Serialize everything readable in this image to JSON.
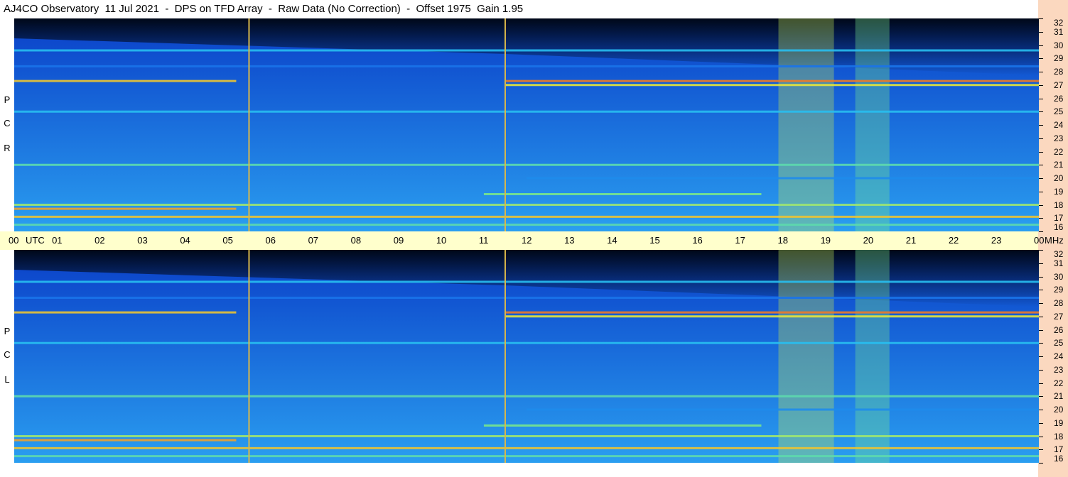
{
  "header": {
    "title": "AJ4CO Observatory  11 Jul 2021  -  DPS on TFD Array  -  Raw Data (No Correction)  -  Offset 1975  Gain 1.95"
  },
  "panels": [
    {
      "name": "rcp",
      "letters": [
        "R",
        "C",
        "P"
      ]
    },
    {
      "name": "lcp",
      "letters": [
        "L",
        "C",
        "P"
      ]
    }
  ],
  "time_axis": {
    "labels": [
      "00",
      "01",
      "02",
      "03",
      "04",
      "05",
      "06",
      "07",
      "08",
      "09",
      "10",
      "11",
      "12",
      "13",
      "14",
      "15",
      "16",
      "17",
      "18",
      "19",
      "20",
      "21",
      "22",
      "23",
      "00"
    ],
    "utc_label": "UTC",
    "unit_label": "MHz"
  },
  "freq_axis": {
    "labels": [
      "32",
      "31",
      "30",
      "29",
      "28",
      "27",
      "26",
      "25",
      "24",
      "23",
      "22",
      "21",
      "20",
      "19",
      "18",
      "17",
      "16"
    ]
  },
  "colors": {
    "background_low": "#0a3fc8",
    "background_high": "#2a9ef0",
    "top_dark": "#000818",
    "time_axis_bg": "#ffffcc",
    "freq_strip_bg": "#fbd8bf",
    "marker_line": "#d9b84a"
  },
  "chart_data": [
    {
      "type": "heatmap",
      "title": "AJ4CO Observatory  11 Jul 2021  -  DPS on TFD Array  -  Raw Data (No Correction)  -  Offset 1975  Gain 1.95",
      "panel": "RCP",
      "xlabel": "UTC",
      "ylabel": "MHz",
      "xlim": [
        0,
        24
      ],
      "ylim": [
        16,
        32
      ],
      "markers_utc": [
        5.5,
        11.5
      ],
      "bands_mhz": [
        {
          "f": 29.6,
          "start": 0,
          "end": 24,
          "level": 0.45
        },
        {
          "f": 28.4,
          "start": 0,
          "end": 24,
          "level": 0.3
        },
        {
          "f": 27.3,
          "start": 0,
          "end": 5.2,
          "level": 0.8
        },
        {
          "f": 27.3,
          "start": 11.5,
          "end": 24,
          "level": 0.9
        },
        {
          "f": 27.0,
          "start": 11.5,
          "end": 24,
          "level": 0.75
        },
        {
          "f": 25.0,
          "start": 0,
          "end": 24,
          "level": 0.45
        },
        {
          "f": 21.0,
          "start": 0,
          "end": 24,
          "level": 0.55
        },
        {
          "f": 20.0,
          "start": 12,
          "end": 24,
          "level": 0.35
        },
        {
          "f": 18.8,
          "start": 11,
          "end": 17.5,
          "level": 0.6
        },
        {
          "f": 18.0,
          "start": 0,
          "end": 24,
          "level": 0.65
        },
        {
          "f": 17.7,
          "start": 0,
          "end": 5.2,
          "level": 0.85
        },
        {
          "f": 17.1,
          "start": 0,
          "end": 24,
          "level": 0.8
        },
        {
          "f": 16.5,
          "start": 0,
          "end": 24,
          "level": 0.55
        }
      ],
      "bursts_utc": [
        {
          "start": 17.9,
          "end": 19.2,
          "level": 0.7
        },
        {
          "start": 19.7,
          "end": 20.5,
          "level": 0.6
        }
      ]
    },
    {
      "type": "heatmap",
      "panel": "LCP",
      "xlabel": "UTC",
      "ylabel": "MHz",
      "xlim": [
        0,
        24
      ],
      "ylim": [
        16,
        32
      ],
      "markers_utc": [
        5.5,
        11.5
      ],
      "bands_mhz": [
        {
          "f": 29.6,
          "start": 0,
          "end": 24,
          "level": 0.45
        },
        {
          "f": 28.4,
          "start": 0,
          "end": 24,
          "level": 0.3
        },
        {
          "f": 27.3,
          "start": 0,
          "end": 5.2,
          "level": 0.8
        },
        {
          "f": 27.3,
          "start": 11.5,
          "end": 24,
          "level": 0.9
        },
        {
          "f": 27.0,
          "start": 11.5,
          "end": 24,
          "level": 0.75
        },
        {
          "f": 25.0,
          "start": 0,
          "end": 24,
          "level": 0.45
        },
        {
          "f": 21.0,
          "start": 0,
          "end": 24,
          "level": 0.55
        },
        {
          "f": 20.0,
          "start": 12,
          "end": 24,
          "level": 0.35
        },
        {
          "f": 18.8,
          "start": 11,
          "end": 17.5,
          "level": 0.6
        },
        {
          "f": 18.0,
          "start": 0,
          "end": 24,
          "level": 0.65
        },
        {
          "f": 17.7,
          "start": 0,
          "end": 5.2,
          "level": 0.85
        },
        {
          "f": 17.1,
          "start": 0,
          "end": 24,
          "level": 0.8
        },
        {
          "f": 16.5,
          "start": 0,
          "end": 24,
          "level": 0.55
        }
      ],
      "bursts_utc": [
        {
          "start": 17.9,
          "end": 19.2,
          "level": 0.7
        },
        {
          "start": 19.7,
          "end": 20.5,
          "level": 0.6
        }
      ]
    }
  ]
}
